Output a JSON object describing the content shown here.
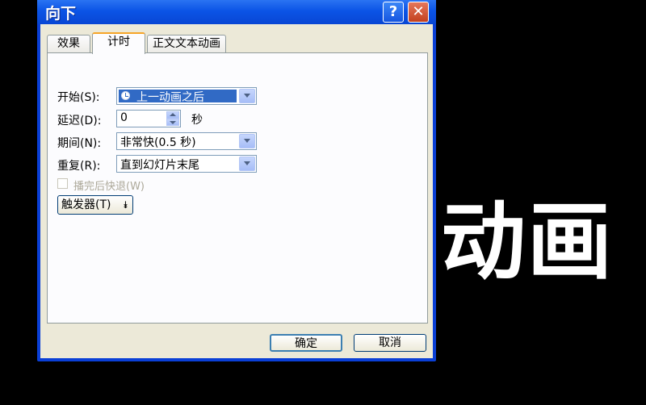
{
  "slide": {
    "big_text": "动画"
  },
  "dialog": {
    "title": "向下",
    "help_glyph": "?",
    "close_glyph": "✕",
    "tabs": [
      {
        "label": "效果"
      },
      {
        "label": "计时"
      },
      {
        "label": "正文文本动画"
      }
    ],
    "active_tab": "计时",
    "fields": {
      "start": {
        "label": "开始(S):",
        "value": "上一动画之后"
      },
      "delay": {
        "label": "延迟(D):",
        "value": "0",
        "unit": "秒"
      },
      "duration": {
        "label": "期间(N):",
        "value": "非常快(0.5 秒)"
      },
      "repeat": {
        "label": "重复(R):",
        "value": "直到幻灯片末尾"
      }
    },
    "rewind_checkbox": {
      "label": "播完后快退(W)",
      "checked": false,
      "enabled": false
    },
    "trigger_button": {
      "label": "触发器(T)",
      "arrow": "⯯"
    },
    "ok_button": "确定",
    "cancel_button": "取消"
  },
  "colors": {
    "title_bar": "#0b54e6",
    "dialog_bg": "#ece9d8",
    "selection": "#316ac5",
    "tab_highlight": "#f6a527",
    "close_button": "#c3411e"
  }
}
